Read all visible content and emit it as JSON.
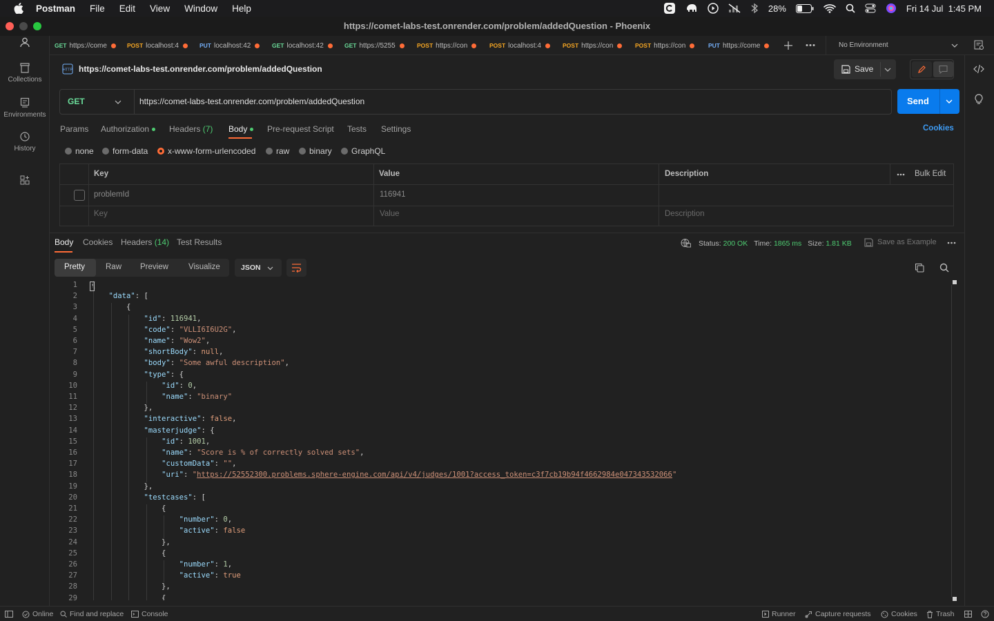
{
  "menubar": {
    "app": "Postman",
    "items": [
      "File",
      "Edit",
      "View",
      "Window",
      "Help"
    ],
    "battery": "28%",
    "clock": "Fri 14 Jul  1:45 PM"
  },
  "window": {
    "title": "https://comet-labs-test.onrender.com/problem/addedQuestion - Phoenix"
  },
  "sidebar": {
    "items": [
      {
        "label": "Collections",
        "icon": "collections-icon"
      },
      {
        "label": "Environments",
        "icon": "environments-icon"
      },
      {
        "label": "History",
        "icon": "history-icon"
      }
    ]
  },
  "tabs": [
    {
      "method": "GET",
      "url": "https://come"
    },
    {
      "method": "POST",
      "url": "localhost:4"
    },
    {
      "method": "PUT",
      "url": "localhost:42"
    },
    {
      "method": "GET",
      "url": "localhost:42"
    },
    {
      "method": "GET",
      "url": "https://5255"
    },
    {
      "method": "POST",
      "url": "https://con"
    },
    {
      "method": "POST",
      "url": "localhost:4"
    },
    {
      "method": "POST",
      "url": "https://con"
    },
    {
      "method": "POST",
      "url": "https://con"
    },
    {
      "method": "PUT",
      "url": "https://come"
    }
  ],
  "environment": "No Environment",
  "request": {
    "name": "https://comet-labs-test.onrender.com/problem/addedQuestion",
    "save_label": "Save",
    "method": "GET",
    "url": "https://comet-labs-test.onrender.com/problem/addedQuestion",
    "send_label": "Send",
    "tabs": {
      "params": "Params",
      "authorization": "Authorization",
      "headers": "Headers",
      "headers_count": "(7)",
      "body": "Body",
      "prerequest": "Pre-request Script",
      "tests": "Tests",
      "settings": "Settings"
    },
    "cookies_label": "Cookies",
    "body_types": [
      "none",
      "form-data",
      "x-www-form-urlencoded",
      "raw",
      "binary",
      "GraphQL"
    ],
    "selected_body_type": "x-www-form-urlencoded",
    "table": {
      "headers": {
        "key": "Key",
        "value": "Value",
        "description": "Description"
      },
      "bulk_edit": "Bulk Edit",
      "rows": [
        {
          "key": "problemId",
          "value": "116941",
          "description": ""
        }
      ],
      "placeholders": {
        "key": "Key",
        "value": "Value",
        "description": "Description"
      }
    }
  },
  "response": {
    "tabs": {
      "body": "Body",
      "cookies": "Cookies",
      "headers": "Headers",
      "headers_count": "(14)",
      "tests": "Test Results"
    },
    "status_label": "Status:",
    "status_value": "200 OK",
    "time_label": "Time:",
    "time_value": "1865 ms",
    "size_label": "Size:",
    "size_value": "1.81 KB",
    "save_example": "Save as Example",
    "view_modes": [
      "Pretty",
      "Raw",
      "Preview",
      "Visualize"
    ],
    "format": "JSON",
    "lines": [
      "{",
      "    \"data\": [",
      "        {",
      "            \"id\": 116941,",
      "            \"code\": \"VLLI6I6U2G\",",
      "            \"name\": \"Wow2\",",
      "            \"shortBody\": null,",
      "            \"body\": \"Some awful description\",",
      "            \"type\": {",
      "                \"id\": 0,",
      "                \"name\": \"binary\"",
      "            },",
      "            \"interactive\": false,",
      "            \"masterjudge\": {",
      "                \"id\": 1001,",
      "                \"name\": \"Score is % of correctly solved sets\",",
      "                \"customData\": \"\",",
      "                \"uri\": \"https://52552300.problems.sphere-engine.com/api/v4/judges/1001?access_token=c3f7cb19b94f4662984e047343532066\"",
      "            },",
      "            \"testcases\": [",
      "                {",
      "                    \"number\": 0,",
      "                    \"active\": false",
      "                },",
      "                {",
      "                    \"number\": 1,",
      "                    \"active\": true",
      "                },",
      "                {"
    ]
  },
  "statusbar": {
    "online": "Online",
    "find": "Find and replace",
    "console": "Console",
    "runner": "Runner",
    "capture": "Capture requests",
    "cookies": "Cookies",
    "trash": "Trash"
  }
}
